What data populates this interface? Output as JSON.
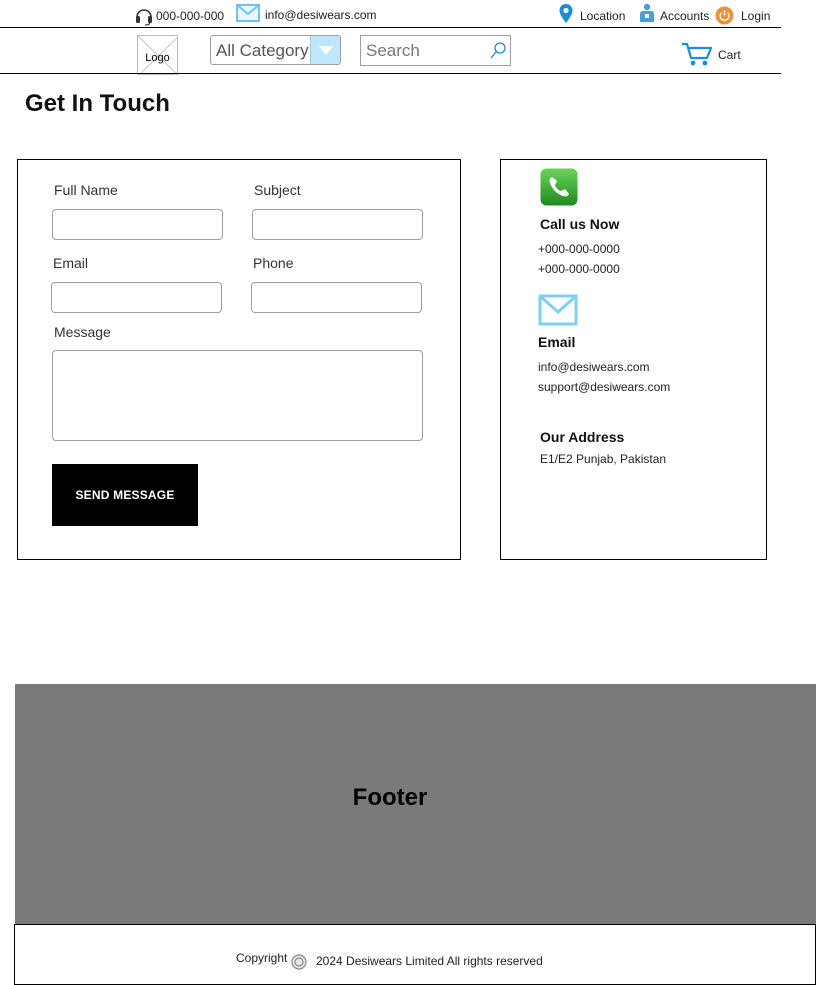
{
  "topbar": {
    "phone": "000-000-000",
    "email": "info@desiwears.com",
    "location_label": "Location",
    "accounts_label": "Accounts",
    "login_label": "Login"
  },
  "header": {
    "logo_label": "Logo",
    "category_select": "All Category",
    "search_placeholder": "Search",
    "cart_label": "Cart"
  },
  "page": {
    "title": "Get In Touch"
  },
  "form": {
    "full_name_label": "Full Name",
    "subject_label": "Subject",
    "email_label": "Email",
    "phone_label": "Phone",
    "message_label": "Message",
    "full_name_value": "",
    "subject_value": "",
    "email_value": "",
    "phone_value": "",
    "message_value": "",
    "send_label": "SEND MESSAGE"
  },
  "contact": {
    "call_heading": "Call us Now",
    "phones": [
      "+000-000-0000",
      "+000-000-0000"
    ],
    "email_heading": "Email",
    "emails": [
      "info@desiwears.com",
      "support@desiwears.com"
    ],
    "address_heading": "Our Address",
    "address": "E1/E2 Punjab, Pakistan"
  },
  "footer": {
    "label": "Footer",
    "copyright_prefix": "Copyright",
    "copyright_text": "2024 Desiwears Limited All rights reserved"
  },
  "colors": {
    "accent_blue": "#1a8fd6",
    "login_orange": "#e8923a",
    "phone_green": "#2aa52f",
    "footer_gray": "#7a7a7a"
  },
  "icons": [
    "headset-icon",
    "mail-icon",
    "location-pin-icon",
    "user-icon",
    "power-icon",
    "dropdown-arrow-icon",
    "search-icon",
    "cart-icon",
    "phone-icon",
    "envelope-icon",
    "copyright-icon"
  ]
}
